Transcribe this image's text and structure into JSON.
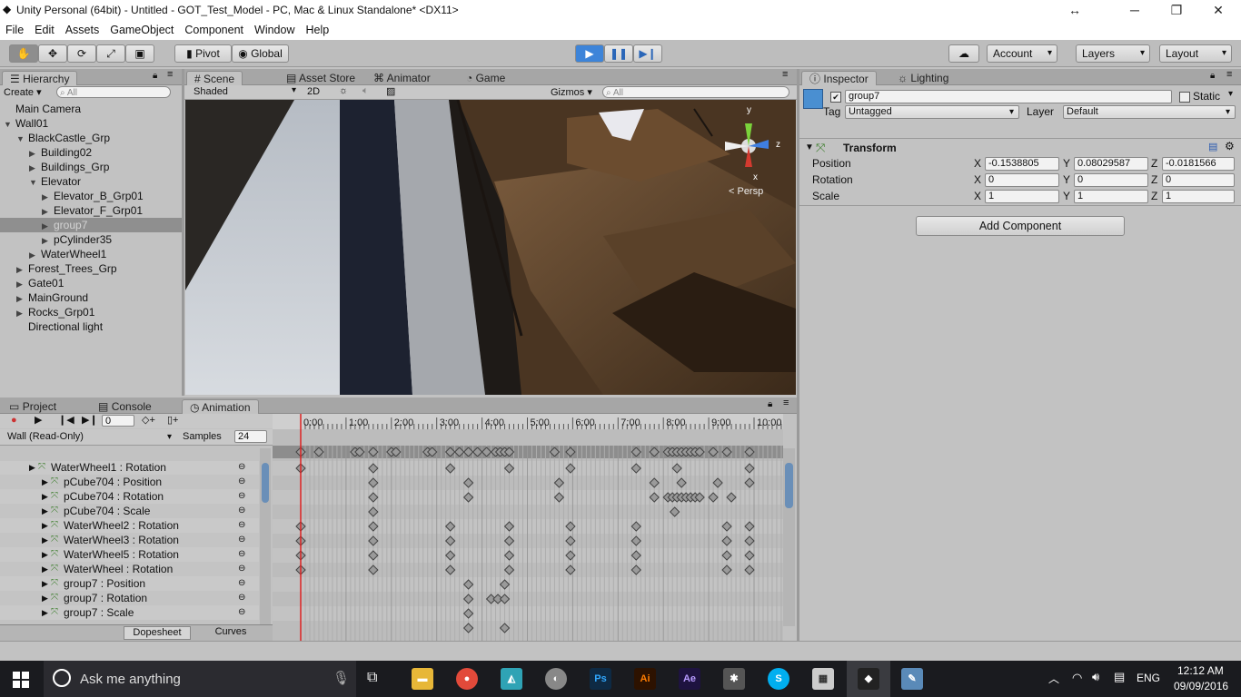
{
  "window": {
    "title": "Unity Personal (64bit) - Untitled - GOT_Test_Model - PC, Mac & Linux Standalone* <DX11>"
  },
  "menu": [
    "File",
    "Edit",
    "Assets",
    "GameObject",
    "Component",
    "Window",
    "Help"
  ],
  "toolbar": {
    "pivot": "Pivot",
    "global": "Global",
    "account": "Account",
    "layers": "Layers",
    "layout": "Layout"
  },
  "hierarchy": {
    "tab": "Hierarchy",
    "create": "Create",
    "search_placeholder": "All",
    "items": [
      {
        "label": "Main Camera",
        "depth": 0,
        "arrow": ""
      },
      {
        "label": "Wall01",
        "depth": 0,
        "arrow": "down"
      },
      {
        "label": "BlackCastle_Grp",
        "depth": 1,
        "arrow": "down"
      },
      {
        "label": "Building02",
        "depth": 2,
        "arrow": "right"
      },
      {
        "label": "Buildings_Grp",
        "depth": 2,
        "arrow": "right"
      },
      {
        "label": "Elevator",
        "depth": 2,
        "arrow": "down"
      },
      {
        "label": "Elevator_B_Grp01",
        "depth": 3,
        "arrow": "right"
      },
      {
        "label": "Elevator_F_Grp01",
        "depth": 3,
        "arrow": "right"
      },
      {
        "label": "group7",
        "depth": 3,
        "arrow": "right",
        "selected": true
      },
      {
        "label": "pCylinder35",
        "depth": 3,
        "arrow": "right"
      },
      {
        "label": "WaterWheel1",
        "depth": 2,
        "arrow": "right"
      },
      {
        "label": "Forest_Trees_Grp",
        "depth": 1,
        "arrow": "right"
      },
      {
        "label": "Gate01",
        "depth": 1,
        "arrow": "right"
      },
      {
        "label": "MainGround",
        "depth": 1,
        "arrow": "right"
      },
      {
        "label": "Rocks_Grp01",
        "depth": 1,
        "arrow": "right"
      },
      {
        "label": "Directional light",
        "depth": 1,
        "arrow": ""
      }
    ]
  },
  "scene": {
    "tabs": [
      "Scene",
      "Asset Store",
      "Animator",
      "Game"
    ],
    "shading": "Shaded",
    "mode2d": "2D",
    "gizmos": "Gizmos",
    "search_placeholder": "All",
    "persp": "< Persp",
    "axis_y": "y",
    "axis_z": "z",
    "axis_x": "x"
  },
  "inspector": {
    "tabs": [
      "Inspector",
      "Lighting"
    ],
    "object_name": "group7",
    "static_label": "Static",
    "tag_label": "Tag",
    "tag_value": "Untagged",
    "layer_label": "Layer",
    "layer_value": "Default",
    "component": "Transform",
    "rows": [
      {
        "label": "Position",
        "x": "-0.1538805",
        "y": "0.08029587",
        "z": "-0.0181566"
      },
      {
        "label": "Rotation",
        "x": "0",
        "y": "0",
        "z": "0"
      },
      {
        "label": "Scale",
        "x": "1",
        "y": "1",
        "z": "1"
      }
    ],
    "add_component": "Add Component"
  },
  "animation": {
    "tabs": [
      "Project",
      "Console",
      "Animation"
    ],
    "frame": "0",
    "clip": "Wall (Read-Only)",
    "samples_label": "Samples",
    "samples": "24",
    "times": [
      "0:00",
      "1:00",
      "2:00",
      "3:00",
      "4:00",
      "5:00",
      "6:00",
      "7:00",
      "8:00",
      "9:00",
      "10:00"
    ],
    "tracks": [
      "WaterWheel1 : Rotation",
      "pCube704 : Position",
      "pCube704 : Rotation",
      "pCube704 : Scale",
      "WaterWheel2 : Rotation",
      "WaterWheel3 : Rotation",
      "WaterWheel5 : Rotation",
      "WaterWheel : Rotation",
      "group7 : Position",
      "group7 : Rotation",
      "group7 : Scale"
    ],
    "bottom_tabs": [
      "Dopesheet",
      "Curves"
    ]
  },
  "taskbar": {
    "search": "Ask me anything",
    "lang": "ENG",
    "time": "12:12 AM",
    "date": "09/09/2016"
  }
}
